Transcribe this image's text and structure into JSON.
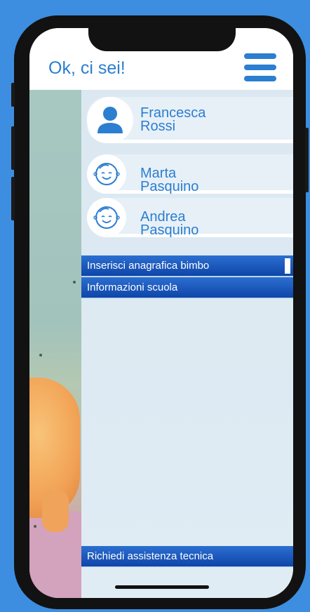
{
  "header": {
    "title": "Ok, ci sei!",
    "menu_icon": "hamburger-menu-icon"
  },
  "users": [
    {
      "name_line1": "Francesca",
      "name_line2": "Rossi",
      "icon": "person-icon"
    },
    {
      "name": "Marta Pasquino",
      "icon": "baby-face-icon"
    },
    {
      "name": "Andrea Pasquino",
      "icon": "baby-face-icon"
    }
  ],
  "menu": {
    "items": [
      {
        "label": "Inserisci anagrafica bimbo"
      },
      {
        "label": "Informazioni scuola"
      }
    ],
    "footer_item": {
      "label": "Richiedi assistenza tecnica"
    }
  },
  "colors": {
    "accent": "#2c7ed0",
    "menu_bar": "#1a55be",
    "panel": "#dde9f2",
    "background": "#3d8ee0"
  }
}
